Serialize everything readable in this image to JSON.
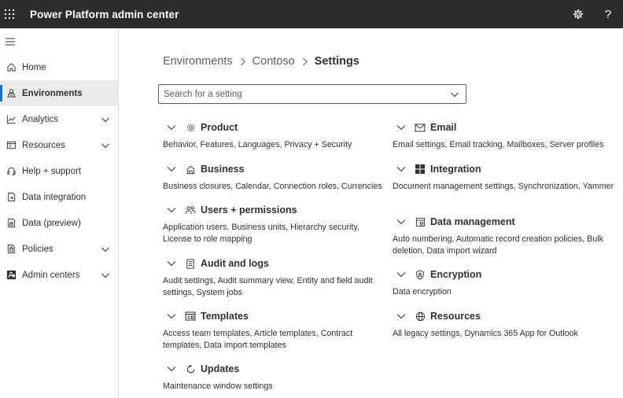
{
  "app": {
    "title": "Power Platform admin center"
  },
  "topbar": {
    "settings_icon": "gear-icon",
    "help_label": "?"
  },
  "sidebar": {
    "items": [
      {
        "label": "Home",
        "icon": "home-icon",
        "expandable": false,
        "selected": false
      },
      {
        "label": "Environments",
        "icon": "environments-icon",
        "expandable": false,
        "selected": true
      },
      {
        "label": "Analytics",
        "icon": "analytics-icon",
        "expandable": true,
        "selected": false
      },
      {
        "label": "Resources",
        "icon": "resources-icon",
        "expandable": true,
        "selected": false
      },
      {
        "label": "Help + support",
        "icon": "headset-icon",
        "expandable": false,
        "selected": false
      },
      {
        "label": "Data integration",
        "icon": "data-integration-icon",
        "expandable": false,
        "selected": false
      },
      {
        "label": "Data (preview)",
        "icon": "data-icon",
        "expandable": false,
        "selected": false
      },
      {
        "label": "Policies",
        "icon": "policies-icon",
        "expandable": true,
        "selected": false
      },
      {
        "label": "Admin centers",
        "icon": "admin-centers-icon",
        "expandable": true,
        "selected": false
      }
    ]
  },
  "breadcrumb": {
    "items": [
      "Environments",
      "Contoso"
    ],
    "current": "Settings"
  },
  "search": {
    "placeholder": "Search for a setting",
    "value": ""
  },
  "sections": [
    {
      "title": "Product",
      "icon": "gear-icon",
      "description": "Behavior, Features, Languages, Privacy + Security"
    },
    {
      "title": "Business",
      "icon": "building-icon",
      "description": "Business closures, Calendar, Connection roles, Currencies"
    },
    {
      "title": "Users + permissions",
      "icon": "people-icon",
      "description": "Application users, Business units, Hierarchy security, License to role mapping"
    },
    {
      "title": "Audit and logs",
      "icon": "document-icon",
      "description": "Audit settings, Audit summary view, Entity and field audit settings, System jobs"
    },
    {
      "title": "Templates",
      "icon": "templates-icon",
      "description": "Access team templates, Article templates, Contract templates, Data import templates"
    },
    {
      "title": "Updates",
      "icon": "refresh-icon",
      "description": "Maintenance window settings"
    },
    {
      "title": "Email",
      "icon": "mail-icon",
      "description": "Email settings, Email tracking, Mailboxes, Server profiles"
    },
    {
      "title": "Integration",
      "icon": "windows-icon",
      "description": "Document management settings, Synchronization, Yammer"
    },
    {
      "title": "Data management",
      "icon": "data-management-icon",
      "description": "Auto numbering, Automatic record creation policies, Bulk deletion, Data import wizard"
    },
    {
      "title": "Encryption",
      "icon": "shield-icon",
      "description": "Data encryption"
    },
    {
      "title": "Resources",
      "icon": "globe-icon",
      "description": "All legacy settings, Dynamics 365 App for Outlook"
    }
  ]
}
